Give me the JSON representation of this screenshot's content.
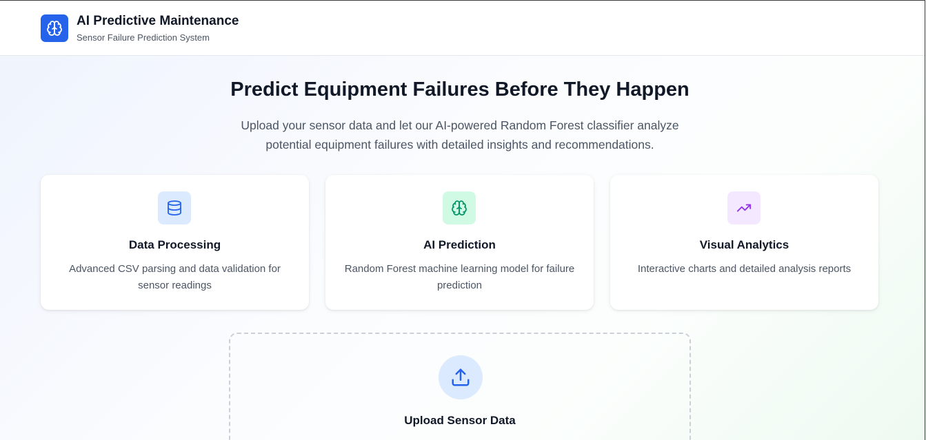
{
  "header": {
    "title": "AI Predictive Maintenance",
    "subtitle": "Sensor Failure Prediction System",
    "logo_icon": "brain-icon",
    "brand_color": "#2563eb"
  },
  "hero": {
    "title": "Predict Equipment Failures Before They Happen",
    "description": "Upload your sensor data and let our AI-powered Random Forest classifier analyze potential equipment failures with detailed insights and recommendations."
  },
  "features": [
    {
      "icon": "database-icon",
      "title": "Data Processing",
      "description": "Advanced CSV parsing and data validation for sensor readings",
      "icon_bg": "#dbeafe",
      "icon_color": "#2563eb"
    },
    {
      "icon": "brain-icon",
      "title": "AI Prediction",
      "description": "Random Forest machine learning model for failure prediction",
      "icon_bg": "#d1fae5",
      "icon_color": "#059669"
    },
    {
      "icon": "trending-up-icon",
      "title": "Visual Analytics",
      "description": "Interactive charts and detailed analysis reports",
      "icon_bg": "#f3e8ff",
      "icon_color": "#9333ea"
    }
  ],
  "upload": {
    "icon": "upload-icon",
    "title": "Upload Sensor Data",
    "hint": ""
  }
}
